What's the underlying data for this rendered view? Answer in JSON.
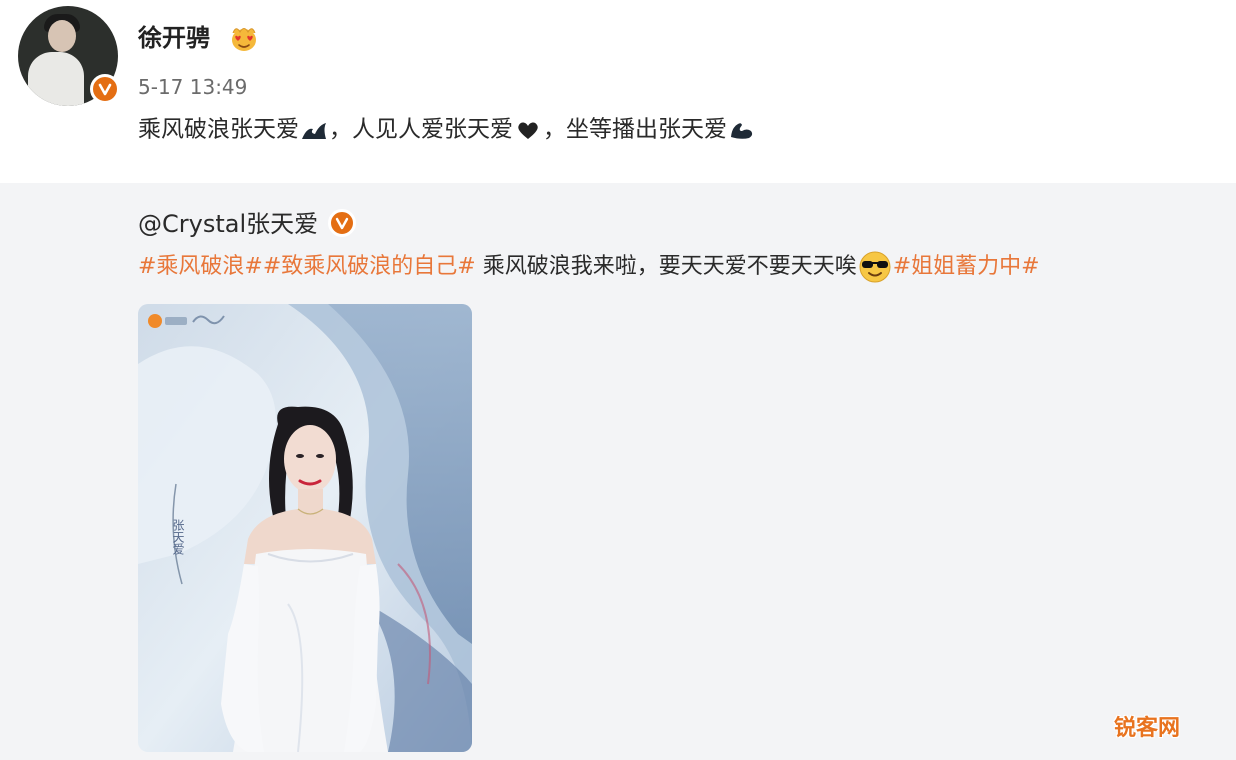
{
  "post": {
    "author": "徐开骋",
    "timestamp": "5-17 13:49",
    "text_part1": "乘风破浪张天爱",
    "text_part2": "，人见人爱张天爱",
    "text_part3": "，坐等播出张天爱",
    "icons": [
      "wave-icon",
      "heart-icon",
      "flexed-arm-icon"
    ]
  },
  "repost": {
    "author_mention": "@Crystal张天爱",
    "hashtag1": "#乘风破浪#",
    "hashtag2": "#致乘风破浪的自己#",
    "text": " 乘风破浪我来啦，要天天爱不要天天唉",
    "hashtag3": "#姐姐蓄力中#",
    "poster_vertical_name": "张天爱"
  },
  "watermark": "锐客网",
  "colors": {
    "hashtag": "#e8773a",
    "verified_badge": "#e46e13",
    "background_repost": "#f3f4f6"
  }
}
